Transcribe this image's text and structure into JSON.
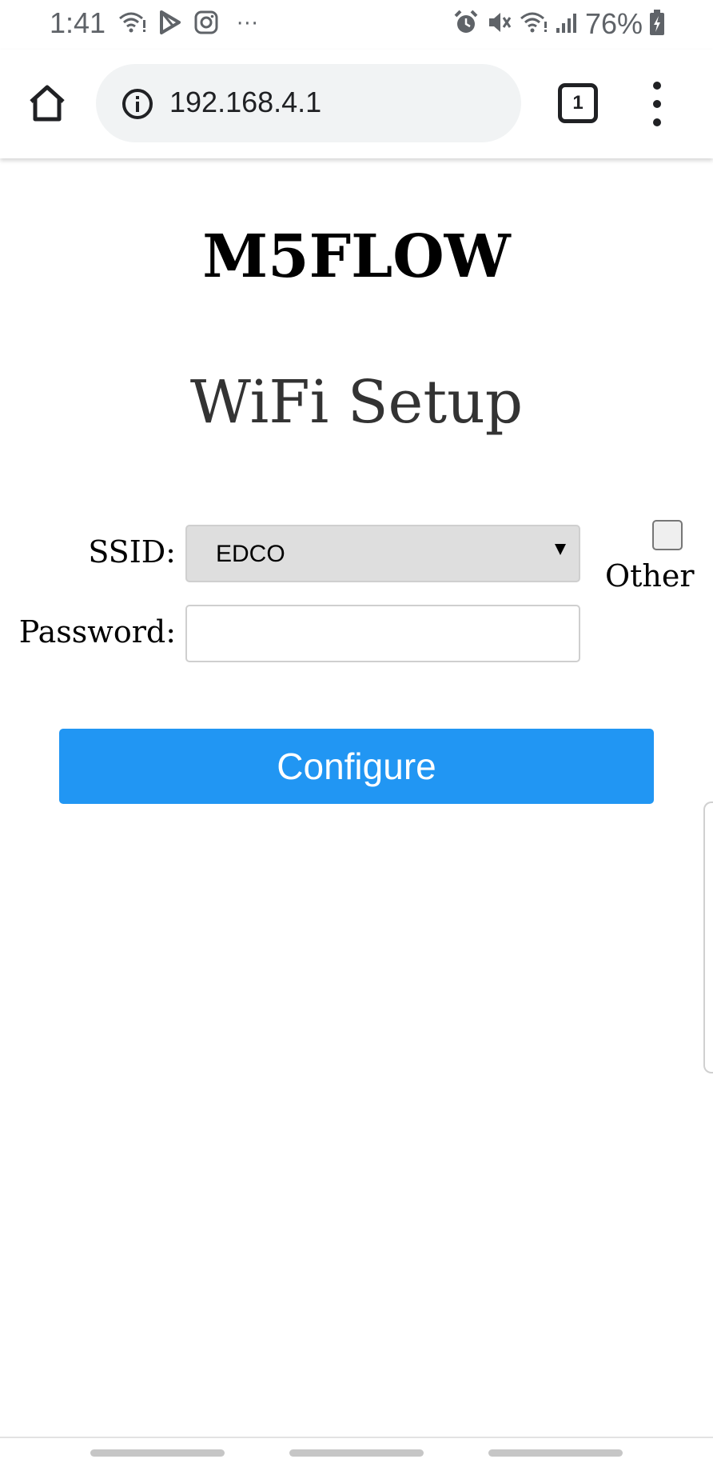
{
  "status_bar": {
    "time": "1:41",
    "left_icons": [
      "wifi-alert-icon",
      "play-store-icon",
      "instagram-icon"
    ],
    "more_dots": "···",
    "right_icons": [
      "alarm-icon",
      "mute-icon",
      "wifi-icon",
      "signal-icon"
    ],
    "battery_percent": "76%",
    "battery_icon": "battery-charging-icon"
  },
  "browser": {
    "home_icon": "home-icon",
    "info_icon": "info-icon",
    "url": "192.168.4.1",
    "tab_count": "1",
    "menu_icon": "more-vert-icon"
  },
  "page": {
    "title": "M5FLOW",
    "subtitle": "WiFi Setup",
    "ssid_label": "SSID:",
    "ssid_selected": "EDCO",
    "other_label": "Other",
    "other_checked": false,
    "password_label": "Password:",
    "password_value": "",
    "configure_label": "Configure"
  },
  "colors": {
    "button_bg": "#2196f3",
    "select_bg": "#dedede",
    "omnibox_bg": "#f1f3f4",
    "status_text": "#5f6368"
  }
}
